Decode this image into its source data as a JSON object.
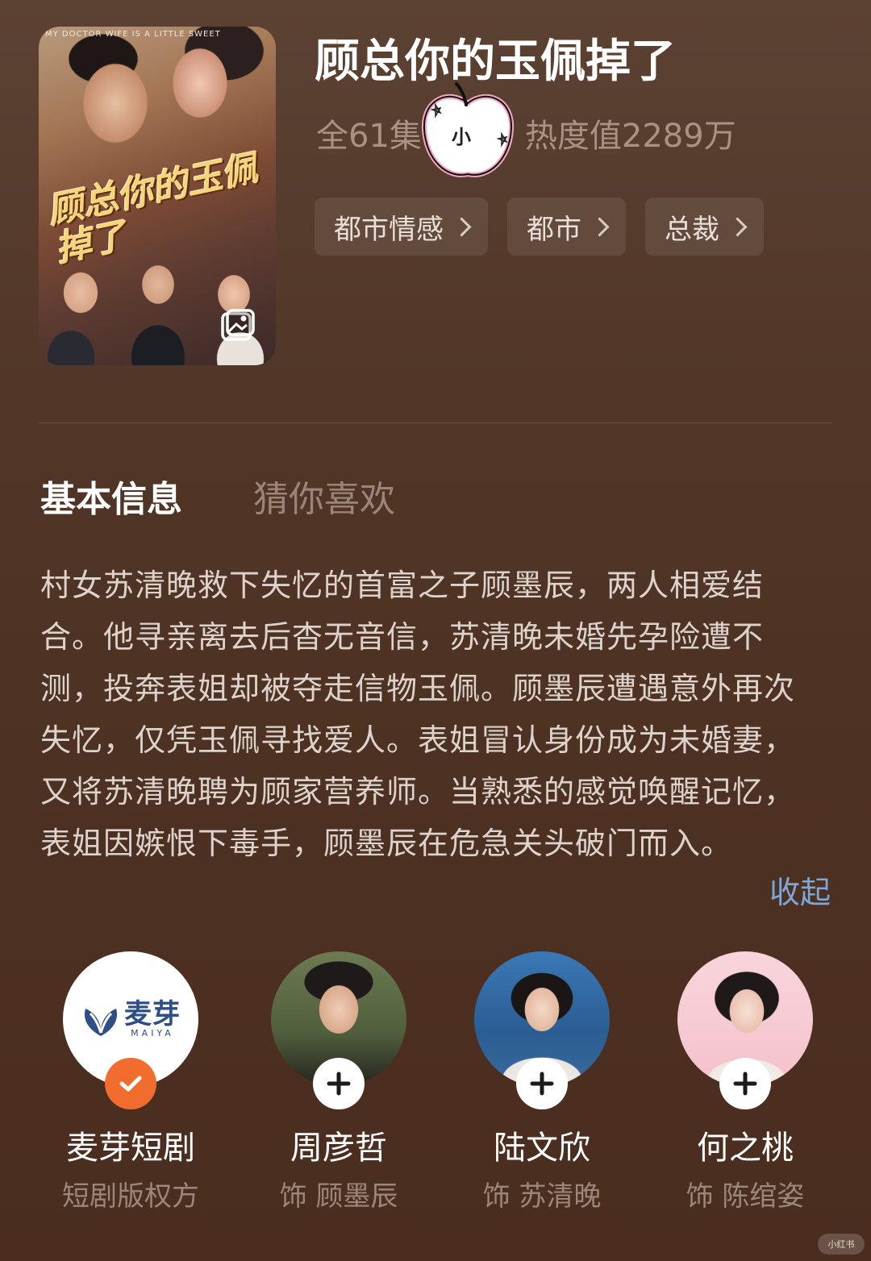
{
  "poster": {
    "top_text": "MY DOCTOR WIFE IS A LITTLE SWEET",
    "title": "顾总你的玉佩掉了",
    "image_icon": "image-gallery-icon"
  },
  "drama": {
    "title": "顾总你的玉佩掉了",
    "episodes": "全61集",
    "popularity": "热度值2289万"
  },
  "sticker": {
    "label": "小"
  },
  "tags": [
    {
      "label": "都市情感"
    },
    {
      "label": "都市"
    },
    {
      "label": "总裁"
    }
  ],
  "tabs": {
    "basic": "基本信息",
    "guess": "猜你喜欢"
  },
  "description": {
    "text": "村女苏清晚救下失忆的首富之子顾墨辰，两人相爱结合。他寻亲离去后杳无音信，苏清晚未婚先孕险遭不测，投奔表姐却被夺走信物玉佩。顾墨辰遭遇意外再次失忆，仅凭玉佩寻找爱人。表姐冒认身份成为未婚妻，又将苏清晚聘为顾家营养师。当熟悉的感觉唤醒记忆，表姐因嫉恨下毒手，顾墨辰在危急关头破门而入。",
    "collapse": "收起"
  },
  "cast": [
    {
      "name": "麦芽短剧",
      "role": "短剧版权方",
      "logo_cn": "麦芽",
      "logo_en": "MAIYA",
      "followed": true
    },
    {
      "name": "周彦哲",
      "role": "饰 顾墨辰",
      "followed": false
    },
    {
      "name": "陆文欣",
      "role": "饰 苏清晚",
      "followed": false
    },
    {
      "name": "何之桃",
      "role": "饰 陈绾姿",
      "followed": false
    }
  ],
  "watermark": "小红书",
  "colors": {
    "accent_link": "#7ea6d8",
    "followed_badge": "#f26c2d",
    "background": "#4d3122"
  }
}
